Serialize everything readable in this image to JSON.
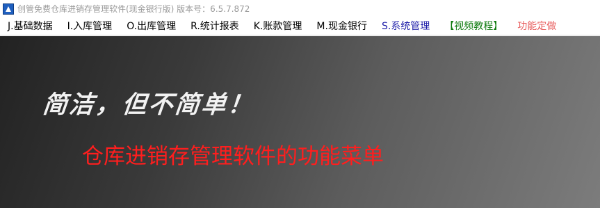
{
  "window": {
    "title": "创管免费仓库进销存管理软件(现金银行版) 版本号：6.5.7.872"
  },
  "menu": {
    "items": [
      {
        "label": "J.基础数据"
      },
      {
        "label": "I.入库管理"
      },
      {
        "label": "O.出库管理"
      },
      {
        "label": "R.统计报表"
      },
      {
        "label": "K.账款管理"
      },
      {
        "label": "M.现金银行"
      },
      {
        "label": "S.系统管理"
      },
      {
        "label": "【视频教程】"
      },
      {
        "label": "功能定做"
      }
    ]
  },
  "banner": {
    "slogan": "简洁，但不简单！",
    "subtitle": "仓库进销存管理软件的功能菜单"
  },
  "colors": {
    "system_menu": "#1c1ca8",
    "video_menu": "#0d7a0d",
    "custom_menu": "#e85d5d",
    "subtitle": "#ff1e1e"
  }
}
